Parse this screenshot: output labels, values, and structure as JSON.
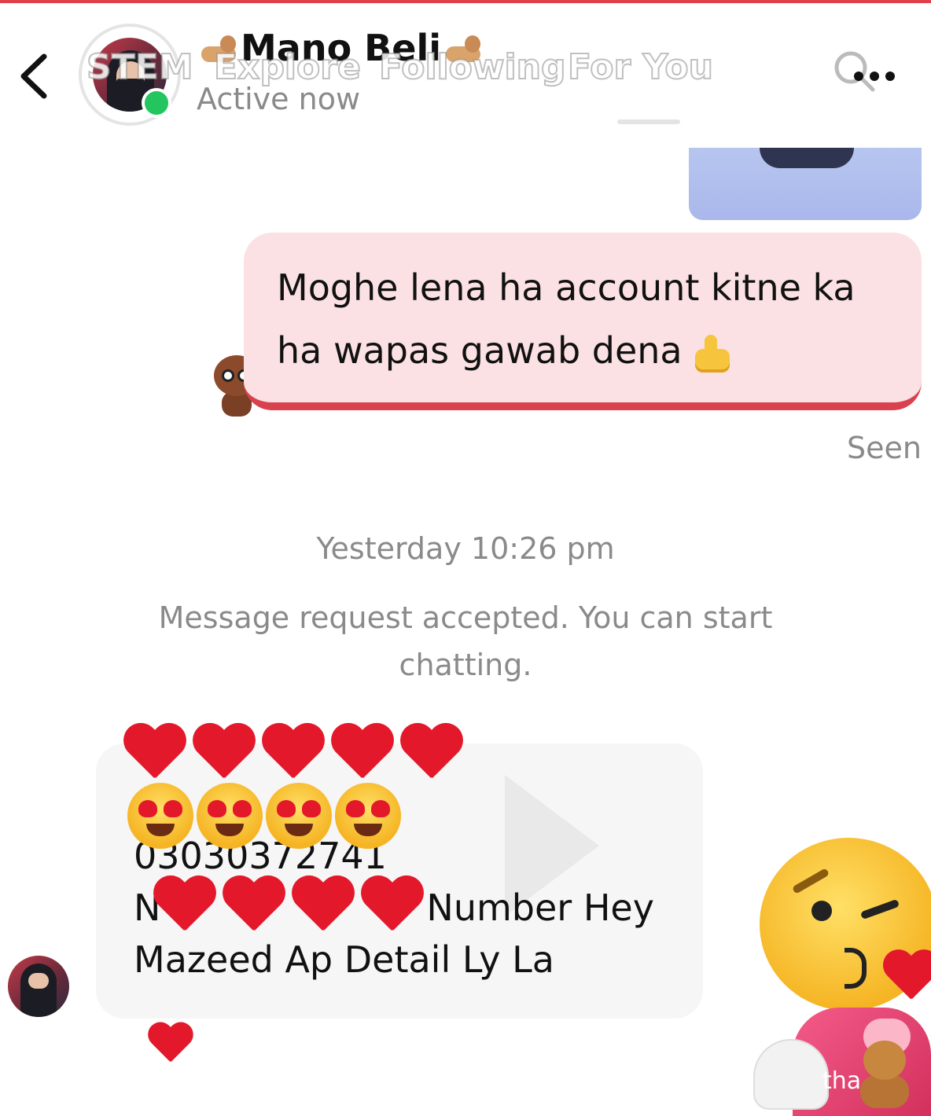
{
  "header": {
    "contact_name": "Mano Beli",
    "status": "Active now",
    "back_icon": "chevron-left-icon",
    "overlay_tabs": [
      "STEM",
      "Explore",
      "Following",
      "For You"
    ],
    "search_icon": "search-icon",
    "more_icon": "more-horizontal-icon",
    "online_color": "#22c55e"
  },
  "messages": {
    "outgoing": {
      "text": "Moghe lena ha account kitne ka ha wapas gawab dena",
      "emoji": "thumbs-up",
      "receipt": "Seen"
    },
    "timestamp": "Yesterday 10:26 pm",
    "system": "Message request accepted. You can start chatting.",
    "incoming": {
      "phone": "03030372741",
      "line2": "Number Hey",
      "line2_prefix": "N",
      "line3": "Mazeed Ap Detail Ly La",
      "reaction": "red-heart"
    }
  },
  "overlay": {
    "partial_text": "tha"
  },
  "colors": {
    "accent": "#d9414f",
    "outgoing_bubble": "#fbe1e3",
    "incoming_bubble": "#f6f6f6",
    "muted_text": "#8a8a8a"
  }
}
